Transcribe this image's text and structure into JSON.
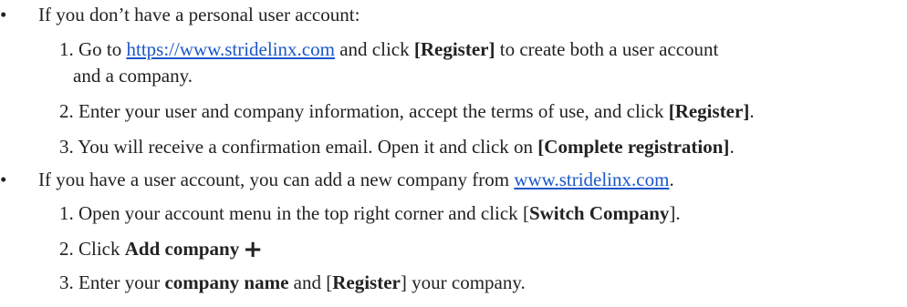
{
  "section1": {
    "bullet": "•",
    "intro": "If you don’t have a personal user account:",
    "step1": {
      "num": "1.",
      "pre": "Go to ",
      "link": "https://www.stridelinx.com",
      "mid": " and click ",
      "btn": "[Register]",
      "post": " to create both a user account",
      "cont": "and a company."
    },
    "step2": {
      "num": "2.",
      "pre": "Enter your user and company information, accept the terms of use, and click ",
      "btn": "[Register]",
      "post": "."
    },
    "step3": {
      "num": "3.",
      "pre": "You will receive a confirmation email. Open it and click on ",
      "btn": "[Complete registration]",
      "post": "."
    }
  },
  "section2": {
    "bullet": "•",
    "intro_pre": "If you have a user account, you can add a new company from ",
    "intro_link": "www.stridelinx.com",
    "intro_post": ".",
    "step1": {
      "num": "1.",
      "pre": "Open your account menu in the top right corner and click ",
      "btn_open": "[",
      "btn": "Switch Company",
      "btn_close": "]",
      "post": "."
    },
    "step2": {
      "num": "2.",
      "pre": "Click ",
      "btn": "Add company",
      "icon": "plus-icon"
    },
    "step3": {
      "num": "3.",
      "pre": "Enter your ",
      "b1": "company name",
      "mid": " and ",
      "b2_open": "[",
      "b2": "Register",
      "b2_close": "]",
      "post": " your company."
    }
  }
}
